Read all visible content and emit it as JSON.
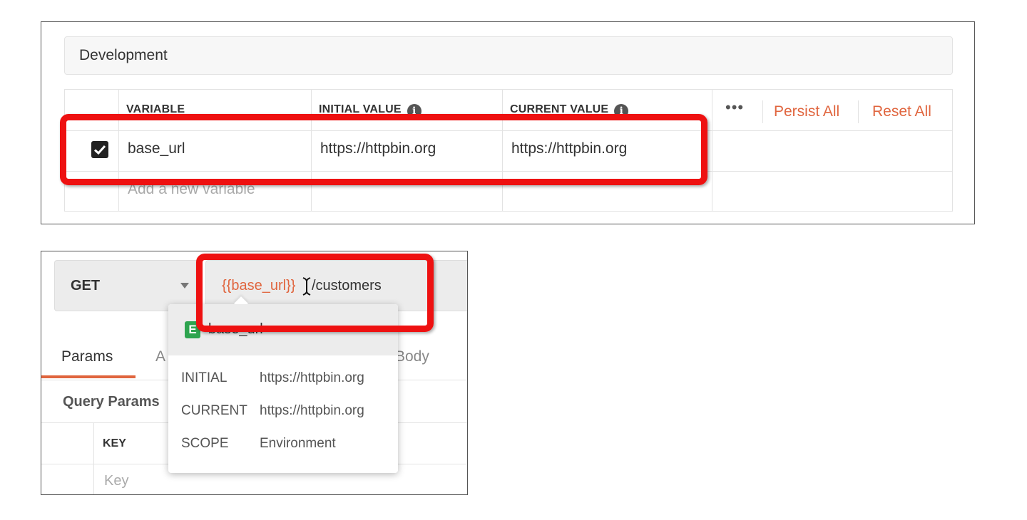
{
  "environment": {
    "name": "Development",
    "columns": {
      "variable": "VARIABLE",
      "initial_value": "INITIAL VALUE",
      "current_value": "CURRENT VALUE"
    },
    "info_icon": "i",
    "more_icon": "•••",
    "actions": {
      "persist_all": "Persist All",
      "reset_all": "Reset All"
    },
    "rows": [
      {
        "enabled": true,
        "variable": "base_url",
        "initial_value": "https://httpbin.org",
        "current_value": "https://httpbin.org"
      }
    ],
    "new_variable_placeholder": "Add a new variable"
  },
  "request": {
    "method": "GET",
    "url_variable": "{{base_url}}",
    "url_rest": "/customers",
    "tabs": [
      {
        "label": "Params"
      },
      {
        "label": "A"
      },
      {
        "label": "Body"
      }
    ],
    "query_params_title": "Query Params",
    "key_header": "KEY",
    "key_placeholder": "Key"
  },
  "variable_popup": {
    "badge": "E",
    "variable": "base_url",
    "fields": [
      {
        "label": "INITIAL",
        "value": "https://httpbin.org"
      },
      {
        "label": "CURRENT",
        "value": "https://httpbin.org"
      },
      {
        "label": "SCOPE",
        "value": "Environment"
      }
    ]
  },
  "colors": {
    "accent": "#e0653e",
    "highlight": "#ee1111",
    "env_badge": "#2ea44f"
  }
}
